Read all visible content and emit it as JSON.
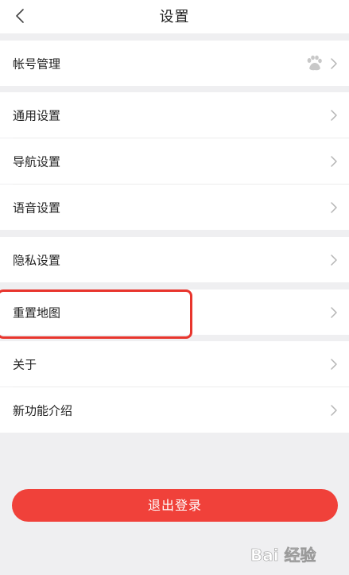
{
  "header": {
    "title": "设置"
  },
  "sections": {
    "account": {
      "label": "帐号管理"
    },
    "general": {
      "label": "通用设置"
    },
    "navigation": {
      "label": "导航设置"
    },
    "voice": {
      "label": "语音设置"
    },
    "privacy": {
      "label": "隐私设置"
    },
    "reset_map": {
      "label": "重置地图"
    },
    "about": {
      "label": "关于"
    },
    "new_features": {
      "label": "新功能介绍"
    }
  },
  "logout_label": "退出登录",
  "watermark_text": "Bai 经验",
  "colors": {
    "accent": "#f0413a",
    "highlight": "#e8352d",
    "background": "#efeff1"
  },
  "icons": {
    "back": "chevron-left-icon",
    "row": "chevron-right-icon",
    "account": "paw-icon"
  }
}
